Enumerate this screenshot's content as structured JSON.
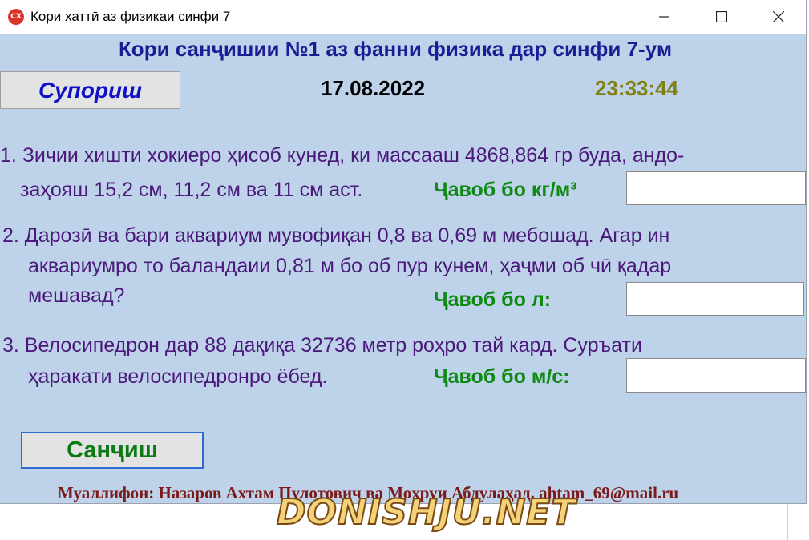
{
  "window": {
    "icon_text": "CX",
    "title": "Кори хаттӣ аз физикаи синфи 7",
    "minimize_glyph": "—",
    "maximize_glyph": "☐",
    "close_glyph": "✕"
  },
  "header": {
    "heading": "Кори санҷишии №1 аз фанни физика дар синфи 7-ум",
    "task_button": "Супориш",
    "date": "17.08.2022",
    "time": "23:33:44"
  },
  "questions": [
    {
      "lines": [
        "1. Зичии хишти хокиеро ҳисоб кунед, ки массааш 4868,864   гр буда, андо-",
        "заҳояш 15,2 см,  11,2 см ва 11    см аст."
      ],
      "answer_label": "Ҷавоб бо кг/м³",
      "answer_value": ""
    },
    {
      "lines": [
        "2. Дарозӣ ва бари аквариум мувофиқан 0,8   ва 0,69 м мебошад. Агар ин",
        "аквариумро то баландаии  0,81 м   бо   об пур кунем, ҳаҷми об чӣ қадар",
        "мешавад?"
      ],
      "answer_label": "Ҷавоб бо л:",
      "answer_value": ""
    },
    {
      "lines": [
        "3. Велосипедрон  дар 88   дақиқа   32736 метр роҳро  тай  кард. Суръати",
        "ҳаракати велосипедронро ёбед."
      ],
      "answer_label": "Ҷавоб бо м/с:",
      "answer_value": ""
    }
  ],
  "footer": {
    "check_button": "Санҷиш",
    "authors": "Муаллифон: Назаров Ахтам Пулотович ва Моҳруи Абдулаҳад. ahtam_69@mail.ru",
    "watermark": "DONISHJU.NET"
  }
}
